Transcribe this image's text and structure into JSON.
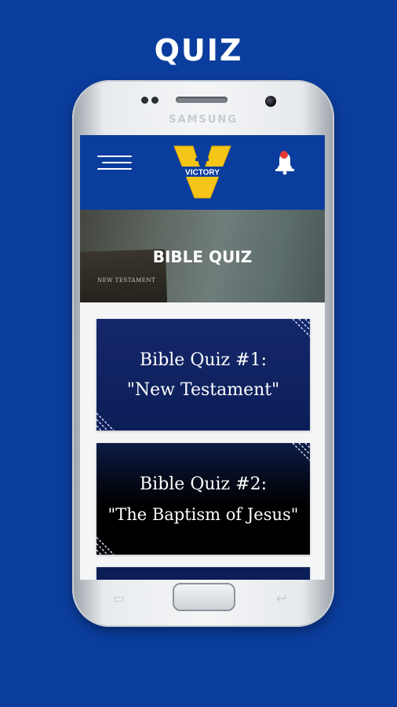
{
  "promo": {
    "title": "QUIZ"
  },
  "device": {
    "brand": "SAMSUNG"
  },
  "app": {
    "logo_text": "VICTORY",
    "banner": {
      "title": "BIBLE QUIZ",
      "book_label": "NEW TESTAMENT"
    },
    "quizzes": [
      {
        "line1": "Bible Quiz #1:",
        "line2": "\"New Testament\""
      },
      {
        "line1": "Bible Quiz #2:",
        "line2": "\"The Baptism of Jesus\""
      }
    ]
  },
  "icons": {
    "menu": "hamburger-menu-icon",
    "notifications": "bell-icon",
    "logo": "victory-logo"
  },
  "colors": {
    "background": "#0b3d9e",
    "header": "#0b3d9e",
    "logo_yellow": "#f5c518",
    "notification_dot": "#e53935"
  }
}
